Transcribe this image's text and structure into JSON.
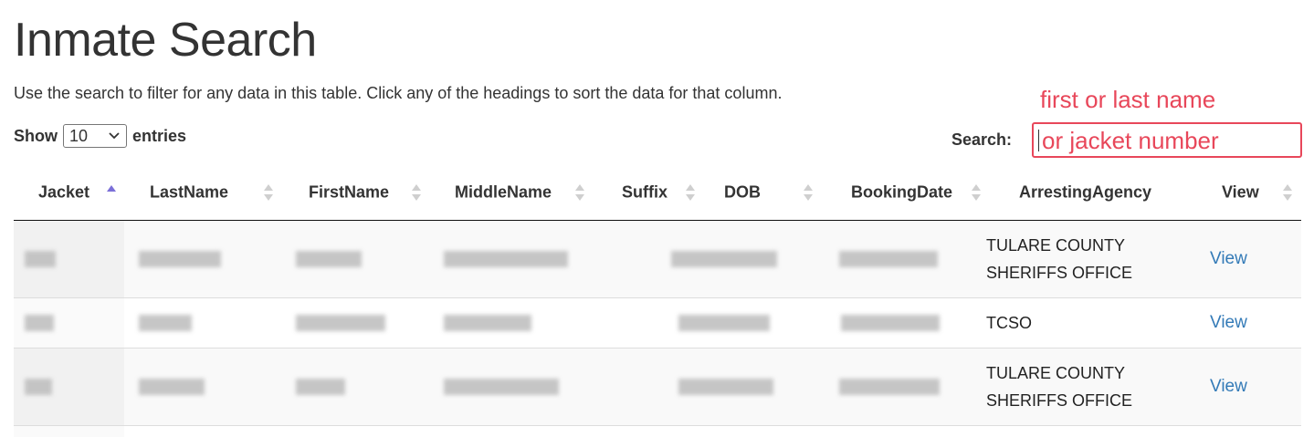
{
  "page": {
    "title": "Inmate Search",
    "instructions": "Use the search to filter for any data in this table. Click any of the headings to sort the data for that column."
  },
  "length_menu": {
    "prefix": "Show",
    "selected": "10",
    "suffix": "entries"
  },
  "search": {
    "label": "Search:",
    "annotation_line1": "first or last name",
    "annotation_line2": "or jacket number"
  },
  "table": {
    "headers": [
      "Jacket",
      "LastName",
      "FirstName",
      "MiddleName",
      "Suffix",
      "DOB",
      "BookingDate",
      "ArrestingAgency",
      "View"
    ],
    "sorted_column": "Jacket",
    "sort_direction": "ascending",
    "rows": [
      {
        "agency_lines": [
          "TULARE COUNTY",
          "SHERIFFS OFFICE"
        ],
        "view": "View"
      },
      {
        "agency_lines": [
          "TCSO"
        ],
        "view": "View"
      },
      {
        "agency_lines": [
          "TULARE COUNTY",
          "SHERIFFS OFFICE"
        ],
        "view": "View"
      }
    ]
  },
  "colors": {
    "accent": "#e8475a",
    "link": "#337ab7",
    "sort_active": "#7b6fd8",
    "sort_inactive": "#cfcfcf"
  }
}
